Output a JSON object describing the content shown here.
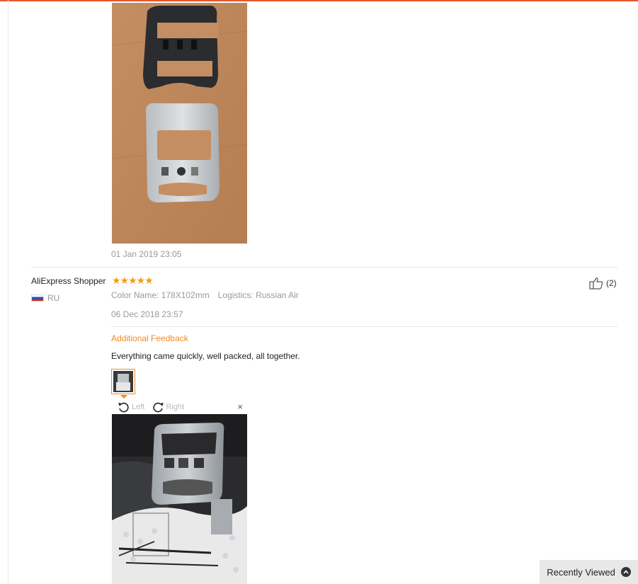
{
  "review1": {
    "date": "01 Jan 2019 23:05"
  },
  "review2": {
    "user": "AliExpress Shopper",
    "stars": "★★★★★",
    "country": "RU",
    "color_name": "Color Name: 178X102mm",
    "logistics": "Logistics: Russian Air",
    "date": "06 Dec 2018 23:57",
    "helpful_count": "(2)",
    "additional_feedback_label": "Additional Feedback",
    "feedback_text": "Everything came quickly, well packed, all together.",
    "viewer": {
      "rotate_left": "Left",
      "rotate_right": "Right",
      "close": "×"
    }
  },
  "recently_viewed": "Recently Viewed",
  "colors": {
    "accent": "#f08a24",
    "star": "#f39c12",
    "topbar": "#e4572e"
  }
}
